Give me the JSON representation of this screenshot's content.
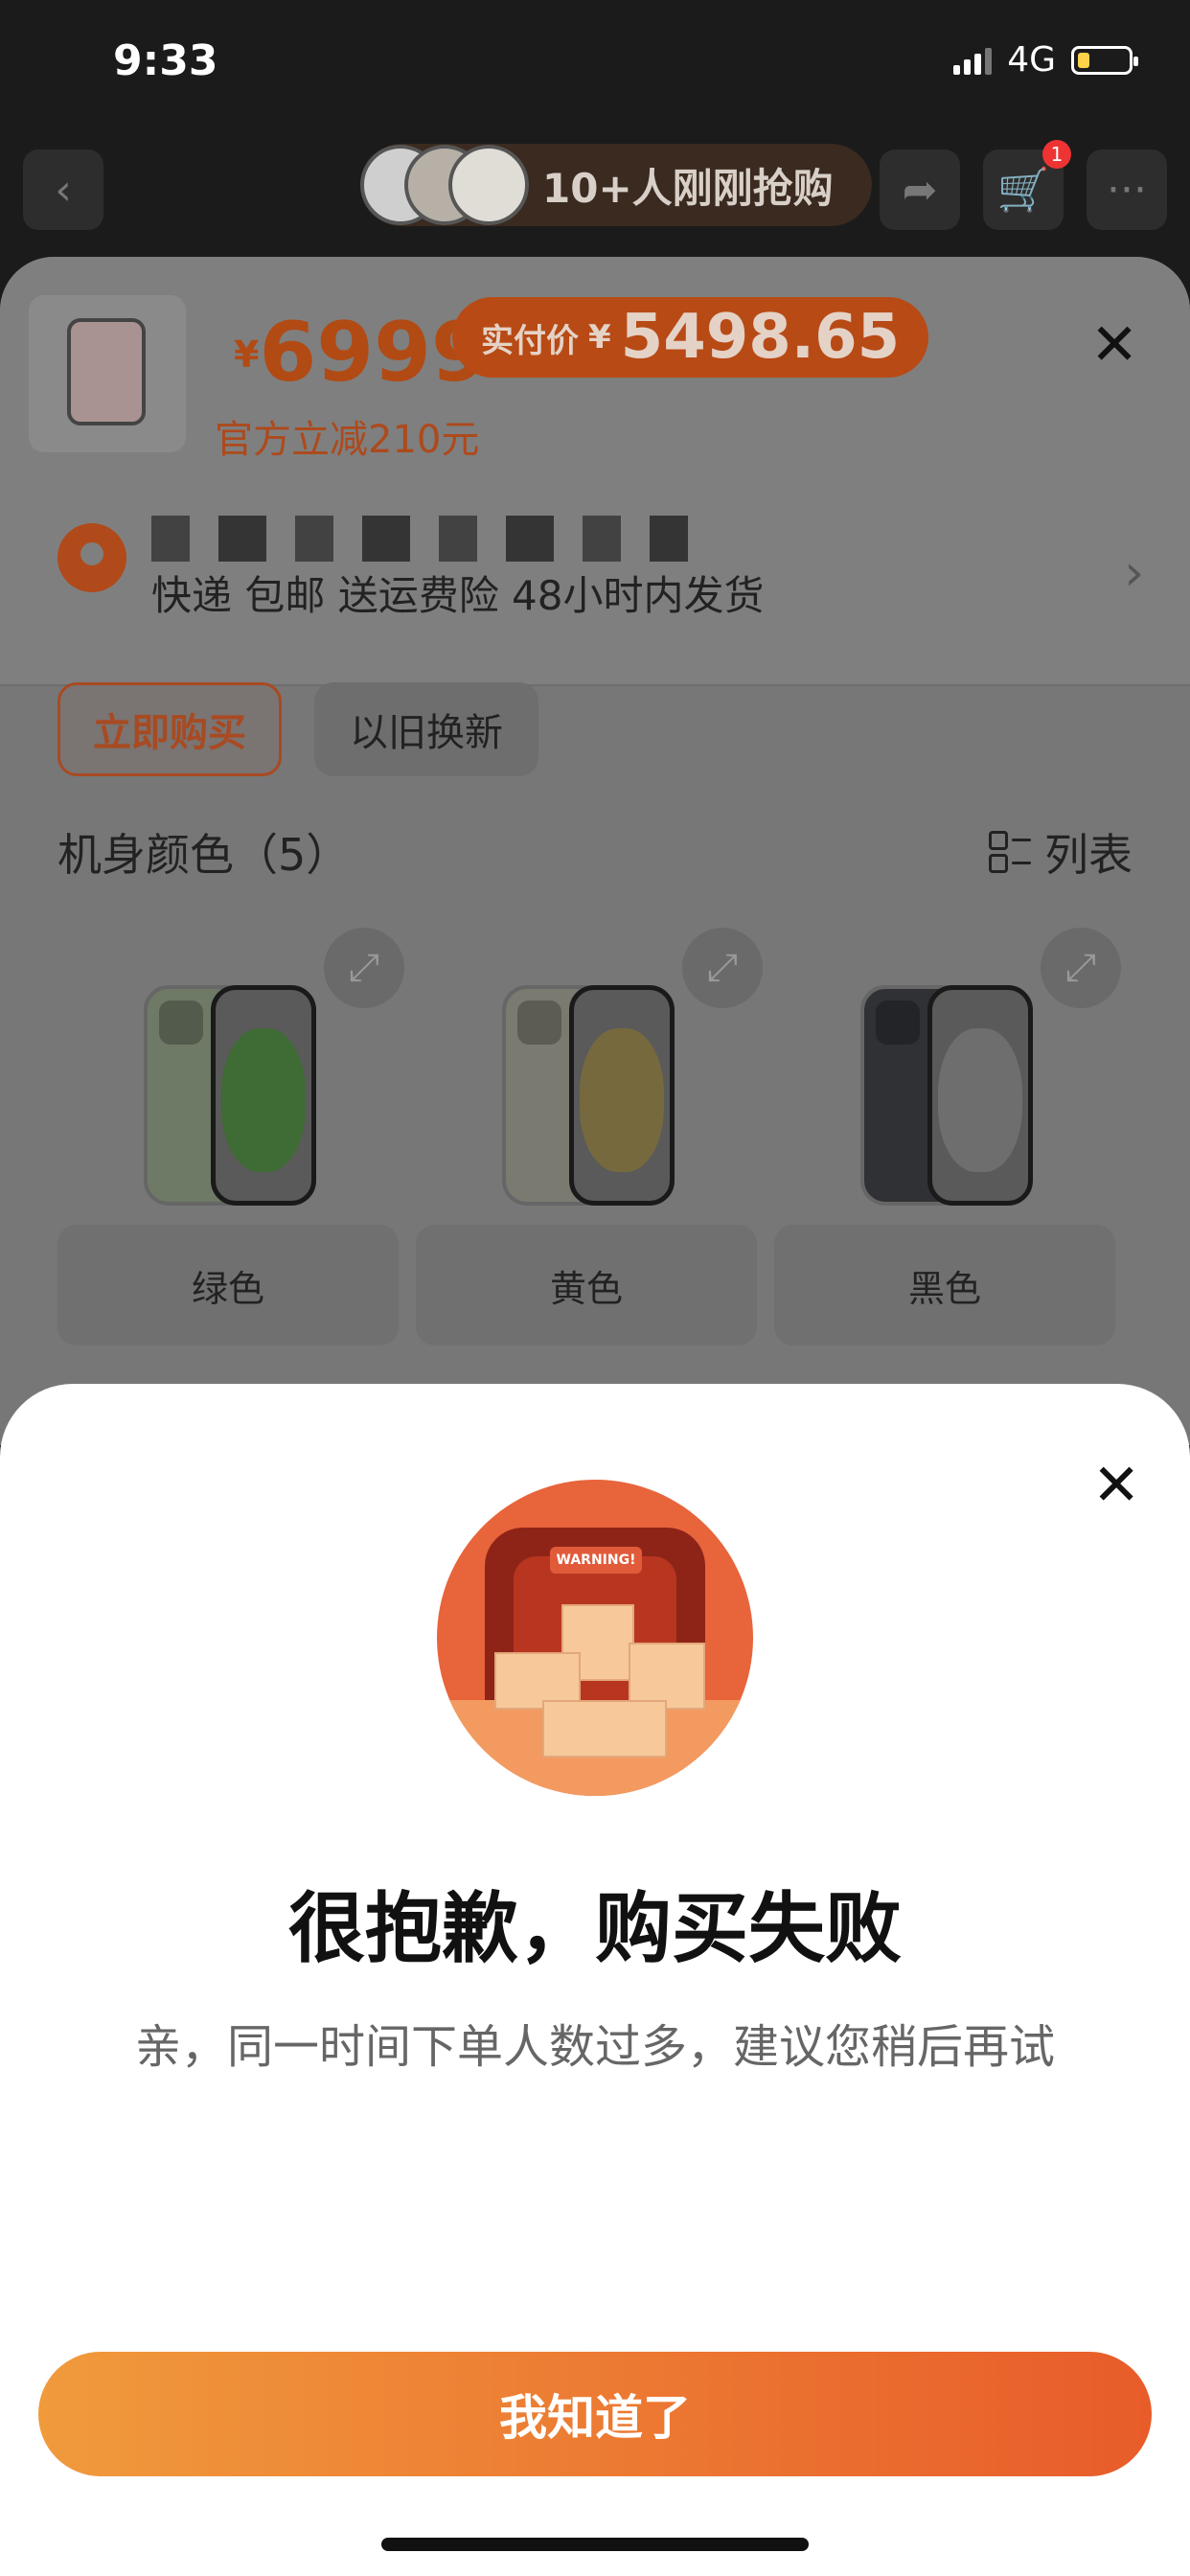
{
  "status_bar": {
    "time": "9:33",
    "network": "4G"
  },
  "header": {
    "buyers_text": "10+人刚刚抢购",
    "cart_badge": "1"
  },
  "product": {
    "currency": "¥",
    "price": "6999",
    "real_pay_label": "实付价",
    "real_pay_currency": "¥",
    "real_pay_value": "5498.65",
    "discount_text": "官方立减210元"
  },
  "shipping": {
    "delivery_text": "快递 包邮 送运费险 48小时内发货"
  },
  "tabs": [
    {
      "label": "立即购买",
      "active": true
    },
    {
      "label": "以旧换新",
      "active": false
    }
  ],
  "color_section": {
    "title": "机身颜色（5）",
    "list_toggle_label": "列表"
  },
  "swatches": [
    {
      "label": "绿色",
      "color": "#6f7a66",
      "blob": "#3f6b34"
    },
    {
      "label": "黄色",
      "color": "#7b7a70",
      "blob": "#77693e"
    },
    {
      "label": "黑色",
      "color": "#2f3134",
      "blob": "#6e6e6e"
    }
  ],
  "modal": {
    "illustration_text": "WARNING!",
    "title": "很抱歉，购买失败",
    "description": "亲，同一时间下单人数过多，建议您稍后再试",
    "confirm_label": "我知道了"
  },
  "colors": {
    "accent": "#e85c2a",
    "accent_light": "#f09a3c"
  }
}
